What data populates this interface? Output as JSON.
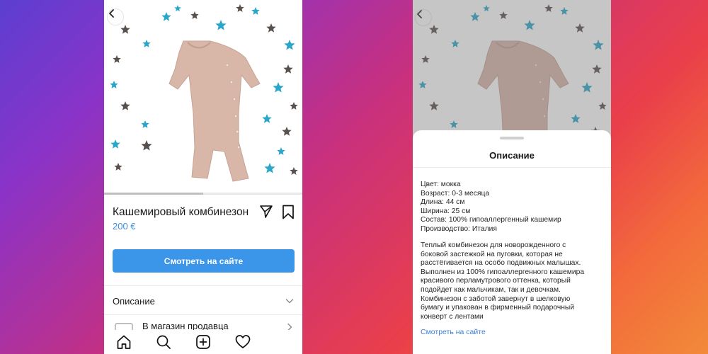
{
  "colors": {
    "accent": "#3b95e8",
    "price": "#3d8fe0",
    "link": "#3b7fd4",
    "garment": "#d8b6a8",
    "star_dark": "#58504d",
    "star_teal": "#2aa6c9"
  },
  "left_screen": {
    "product": {
      "title": "Кашемировый комбинезон",
      "price": "200 €"
    },
    "cta_label": "Смотреть на сайте",
    "description_row_label": "Описание",
    "shop_row_label": "В магазин продавца",
    "carousel_progress": 0.5,
    "tabs": [
      "home-icon",
      "search-icon",
      "add-post-icon",
      "heart-icon"
    ]
  },
  "right_screen": {
    "sheet_title": "Описание",
    "specs": [
      "Цвет: мокка",
      "Возраст: 0-3 месяца",
      "Длина: 44 см",
      "Ширина: 25 см",
      "Состав: 100% гипоаллергенный кашемир",
      "Производство: Италия"
    ],
    "description_lines": [
      "Теплый комбинезон для новорожденного с",
      "боковой застежкой на пуговки, которая не",
      "расстёгивается на особо подвижных малышах.",
      "Выполнен из 100% гипоаллергенного кашемира",
      "красивого перламутрового оттенка, который",
      "подойдет как мальчикам, так и девочкам.",
      "Комбинезон с заботой завернут в шелковую",
      "бумагу и упакован в фирменный подарочный",
      "конверт с лентами"
    ],
    "link_label": "Смотреть на сайте"
  }
}
